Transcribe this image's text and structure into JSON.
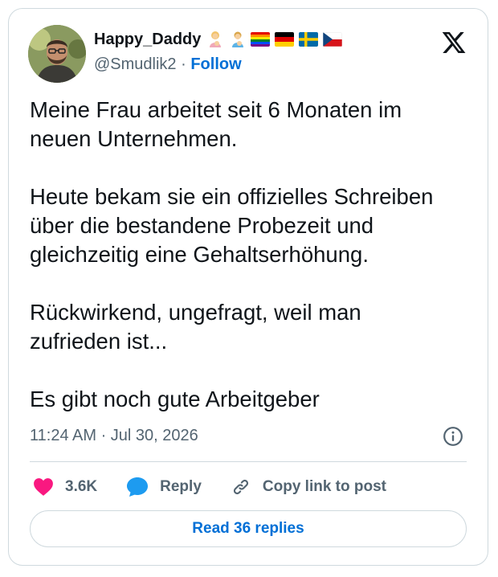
{
  "author": {
    "display_name": "Happy_Daddy",
    "handle": "@Smudlik2",
    "separator": " · ",
    "follow_label": "Follow",
    "name_emoji_icons": [
      "woman-feeding-baby-icon",
      "man-feeding-baby-icon"
    ],
    "flags": [
      "rainbow-flag-icon",
      "germany-flag-icon",
      "sweden-flag-icon",
      "czech-flag-icon"
    ]
  },
  "tweet": {
    "paragraphs": [
      "Meine Frau arbeitet seit 6 Monaten im\nneuen Unternehmen.",
      "Heute bekam sie ein offizielles Schreiben\nüber die bestandene Probezeit und\ngleichzeitig eine Gehaltserhöhung.",
      "Rückwirkend, ungefragt, weil man\nzufrieden ist...",
      "Es gibt noch gute Arbeitgeber"
    ],
    "timestamp": "11:24 AM · Jul 30, 2026"
  },
  "actions": {
    "like_count": "3.6K",
    "reply_label": "Reply",
    "copy_link_label": "Copy link to post"
  },
  "footer": {
    "read_replies_label": "Read 36 replies"
  },
  "colors": {
    "link_blue": "#006fd6",
    "like_pink": "#f91880",
    "reply_blue": "#1d9bf0",
    "muted_text": "#536471",
    "border": "#cfd9de"
  }
}
